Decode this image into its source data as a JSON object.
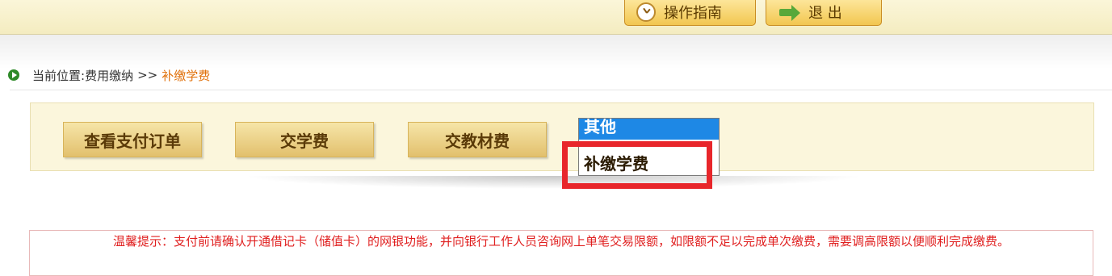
{
  "header": {
    "guide_label": "操作指南",
    "guide_icon": "clock-icon",
    "exit_label": "退 出",
    "exit_icon": "exit-arrow-icon"
  },
  "breadcrumb": {
    "prefix": "当前位置: ",
    "parent": "费用缴纳",
    "separator": ">>",
    "current": "补缴学费",
    "icon": "arrow-circle-icon",
    "current_color": "#e0700a"
  },
  "menu": {
    "buttons": [
      {
        "label": "查看支付订单"
      },
      {
        "label": "交学费"
      },
      {
        "label": "交教材费"
      }
    ],
    "dropdown": {
      "selected": "其他",
      "options": [
        "补缴学费"
      ]
    }
  },
  "tip": {
    "text": "温馨提示：支付前请确认开通借记卡（储值卡）的网银功能，并向银行工作人员咨询网上单笔交易限额，如限额不足以完成单次缴费，需要调高限额以便顺利完成缴费。"
  },
  "colors": {
    "highlight": "#e8262b",
    "tip_text": "#e02020",
    "dropdown_selected": "#1e88e5"
  }
}
